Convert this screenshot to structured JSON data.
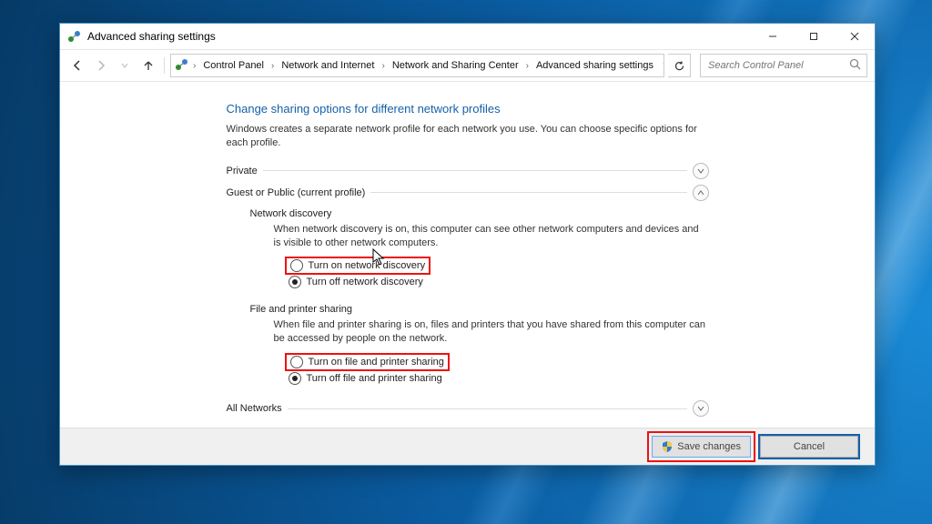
{
  "window": {
    "title": "Advanced sharing settings"
  },
  "breadcrumb": {
    "segs": [
      "Control Panel",
      "Network and Internet",
      "Network and Sharing Center",
      "Advanced sharing settings"
    ]
  },
  "search": {
    "placeholder": "Search Control Panel"
  },
  "page": {
    "title": "Change sharing options for different network profiles",
    "subtitle": "Windows creates a separate network profile for each network you use. You can choose specific options for each profile."
  },
  "sections": {
    "private": {
      "label": "Private"
    },
    "guest": {
      "label": "Guest or Public (current profile)"
    },
    "all": {
      "label": "All Networks"
    }
  },
  "network_discovery": {
    "heading": "Network discovery",
    "desc": "When network discovery is on, this computer can see other network computers and devices and is visible to other network computers.",
    "on": "Turn on network discovery",
    "off": "Turn off network discovery"
  },
  "file_printer": {
    "heading": "File and printer sharing",
    "desc": "When file and printer sharing is on, files and printers that you have shared from this computer can be accessed by people on the network.",
    "on": "Turn on file and printer sharing",
    "off": "Turn off file and printer sharing"
  },
  "footer": {
    "save": "Save changes",
    "cancel": "Cancel"
  }
}
